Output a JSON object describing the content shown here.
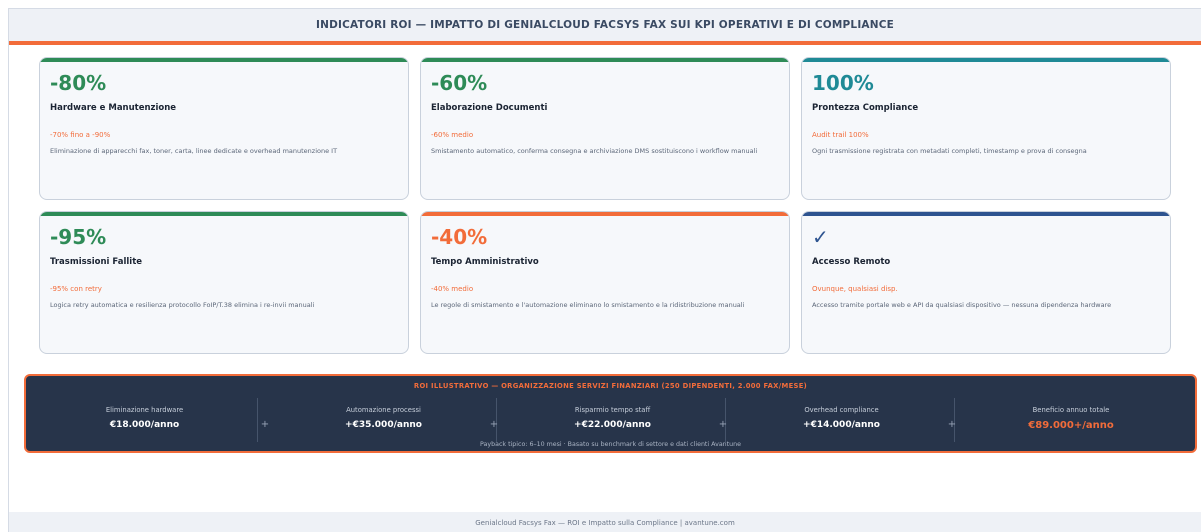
{
  "header": {
    "title": "INDICATORI ROI — IMPATTO DI GENIALCLOUD FACSYS FAX SUI KPI OPERATIVI E DI COMPLIANCE"
  },
  "colors": {
    "green": "#2e8b57",
    "teal": "#1f8a96",
    "orange": "#f26c3a",
    "navy": "#2e5490",
    "dark": "#27344a"
  },
  "cards": [
    {
      "value": "-80%",
      "title": "Hardware e Manutenzione",
      "sub": "-70% fino a -90%",
      "desc": "Eliminazione di apparecchi fax, toner, carta, linee dedicate e overhead manutenzione IT",
      "accent": "#2e8b57"
    },
    {
      "value": "-60%",
      "title": "Elaborazione Documenti",
      "sub": "-60% medio",
      "desc": "Smistamento automatico, conferma consegna e archiviazione DMS sostituiscono i workflow manuali",
      "accent": "#2e8b57"
    },
    {
      "value": "100%",
      "title": "Prontezza Compliance",
      "sub": "Audit trail 100%",
      "desc": "Ogni trasmissione registrata con metadati completi, timestamp e prova di consegna",
      "accent": "#1f8a96"
    },
    {
      "value": "-95%",
      "title": "Trasmissioni Fallite",
      "sub": "-95% con retry",
      "desc": "Logica retry automatica e resilienza protocollo FoIP/T.38 elimina i re-invii manuali",
      "accent": "#2e8b57"
    },
    {
      "value": "-40%",
      "title": "Tempo Amministrativo",
      "sub": "-40% medio",
      "desc": "Le regole di smistamento e l'automazione eliminano lo smistamento e la ridistribuzione manuali",
      "accent": "#f26c3a"
    },
    {
      "value": "✓",
      "title": "Accesso Remoto",
      "sub": "Ovunque, qualsiasi disp.",
      "desc": "Accesso tramite portale web e API da qualsiasi dispositivo — nessuna dipendenza hardware",
      "accent": "#2e5490"
    }
  ],
  "roi": {
    "title": "ROI ILLUSTRATIVO — ORGANIZZAZIONE SERVIZI FINANZIARI (250 DIPENDENTI, 2.000 FAX/MESE)",
    "items": [
      {
        "label": "Eliminazione hardware",
        "value": "€18.000/anno"
      },
      {
        "label": "Automazione processi",
        "value": "+€35.000/anno"
      },
      {
        "label": "Risparmio tempo staff",
        "value": "+€22.000/anno"
      },
      {
        "label": "Overhead compliance",
        "value": "+€14.000/anno"
      },
      {
        "label": "Beneficio annuo totale",
        "value": "€89.000+/anno"
      }
    ],
    "plus": "+",
    "footnote": "Payback tipico: 6–10 mesi · Basato su benchmark di settore e dati clienti Avantune"
  },
  "footer": {
    "text": "Genialcloud Facsys Fax — ROI e Impatto sulla Compliance  |  avantune.com"
  }
}
